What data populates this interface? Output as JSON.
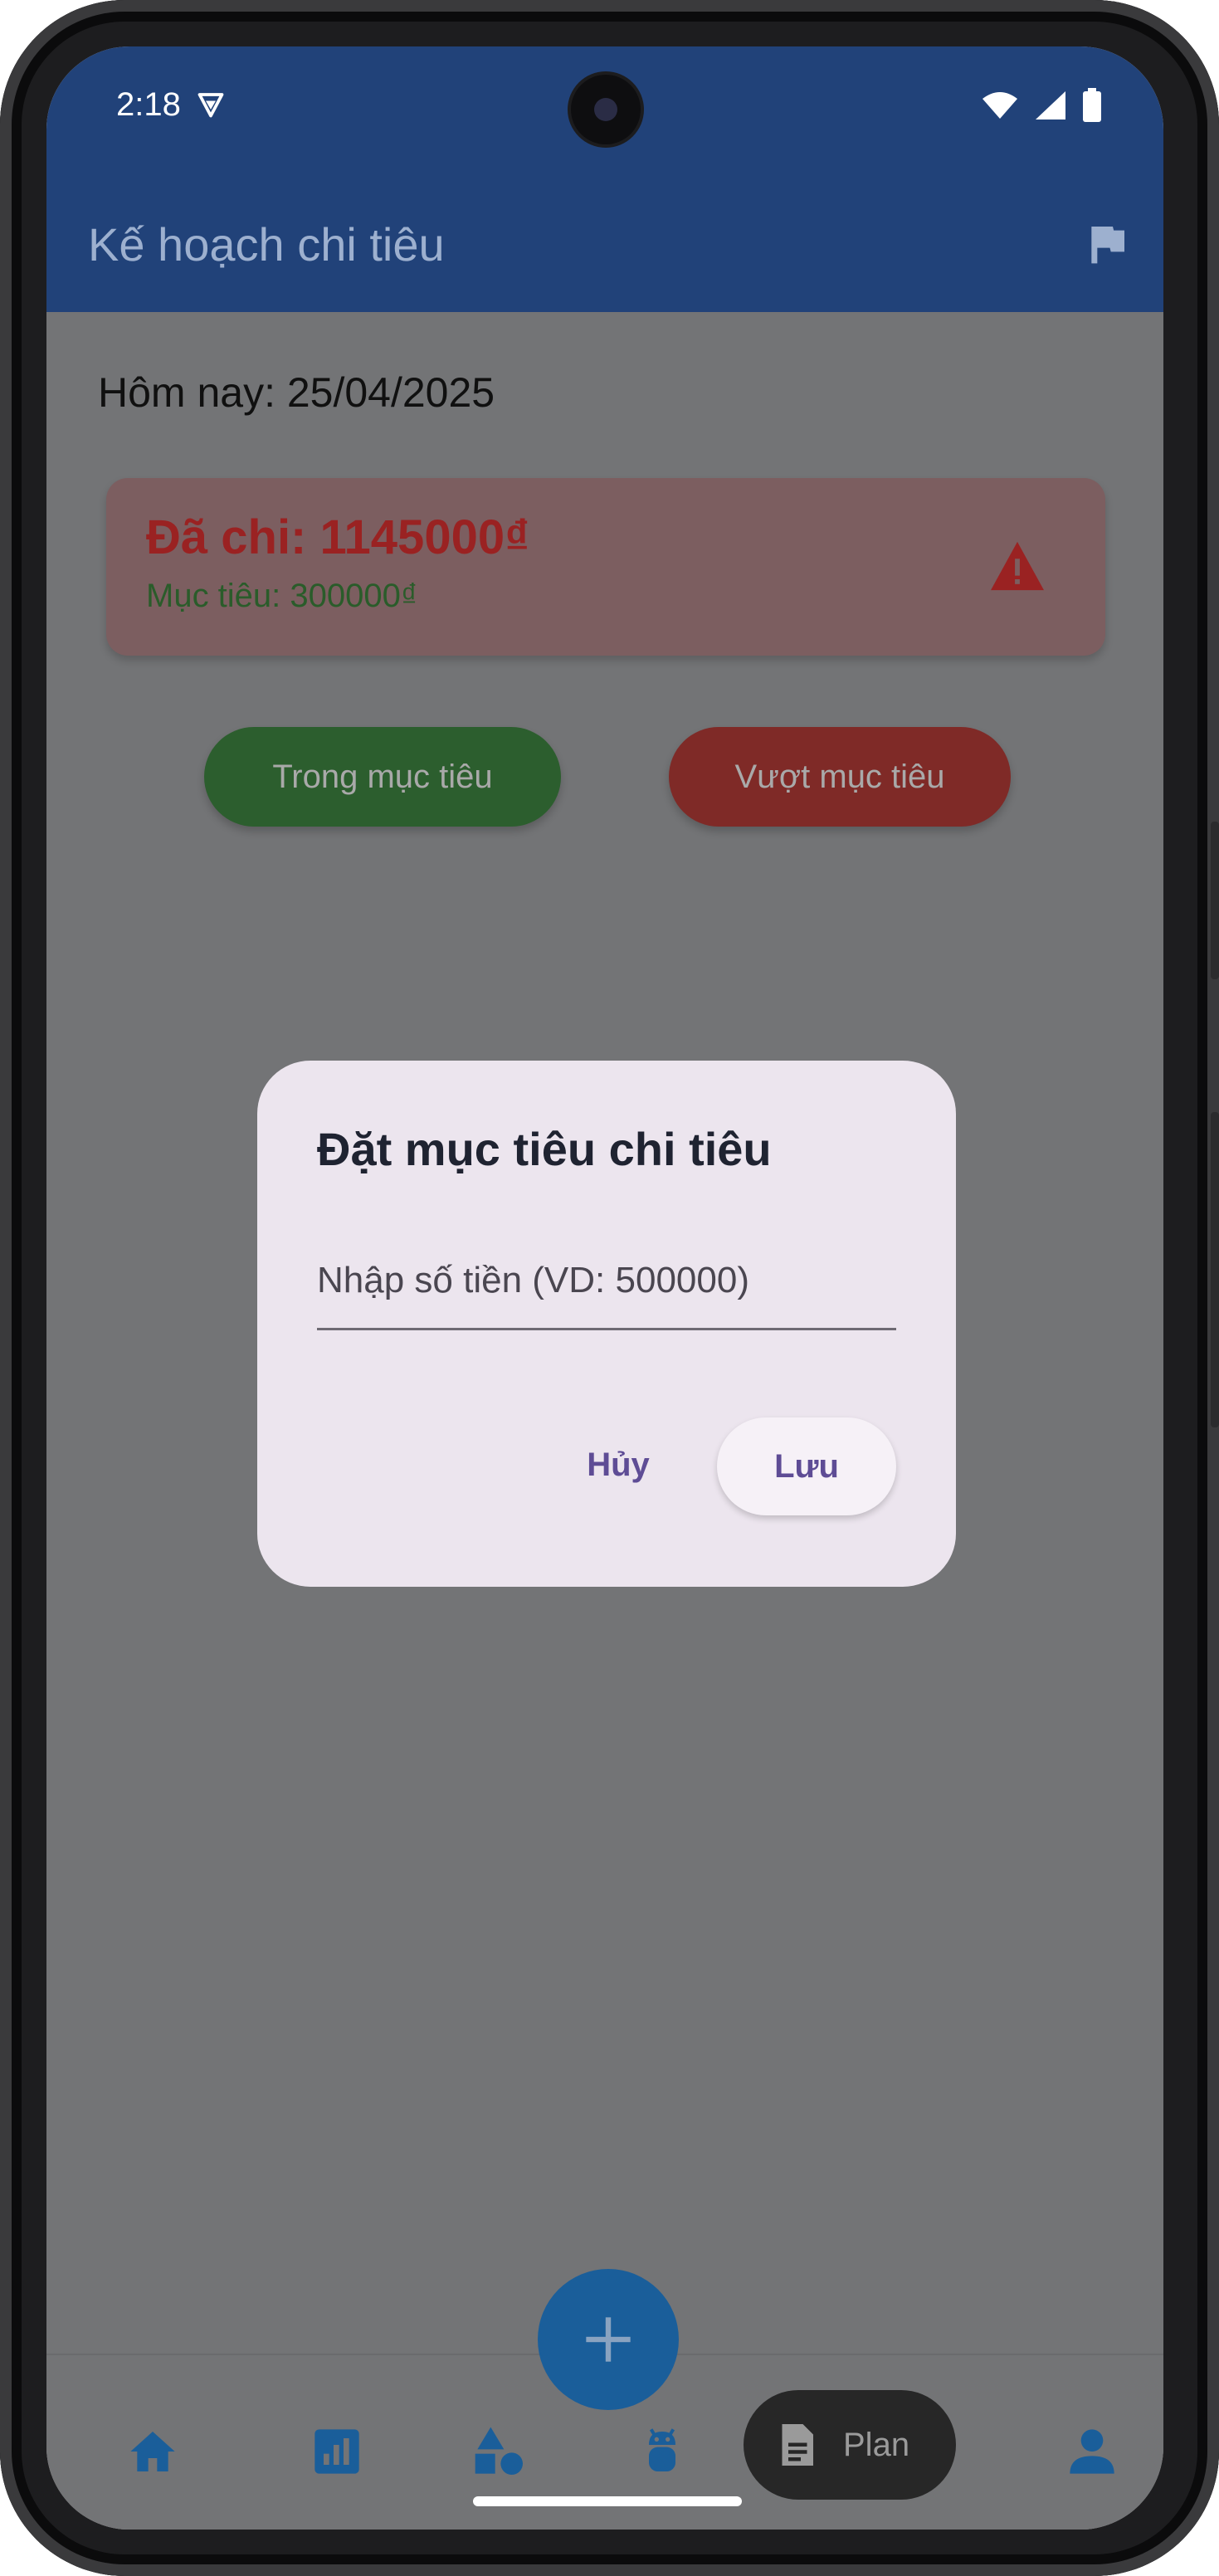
{
  "status_bar": {
    "time": "2:18"
  },
  "app_bar": {
    "title": "Kế hoạch chi tiêu"
  },
  "today": {
    "label": "Hôm nay: 25/04/2025"
  },
  "summary_card": {
    "spent": "Đã chi: 1145000₫",
    "target": "Mục tiêu: 300000₫"
  },
  "filter_buttons": {
    "in_target": "Trong mục tiêu",
    "over_target": "Vượt mục tiêu"
  },
  "dialog": {
    "title": "Đặt mục tiêu chi tiêu",
    "input_placeholder": "Nhập số tiền (VD: 500000)",
    "cancel_label": "Hủy",
    "save_label": "Lưu"
  },
  "bottom_nav": {
    "items": [
      "home-icon",
      "bar-chart-icon",
      "shapes-icon",
      "android-icon",
      "plan-document-icon",
      "person-icon"
    ],
    "active_label": "Plan"
  },
  "colors": {
    "app_bar": "#214279",
    "spent_text": "#9a2222",
    "target_text": "#2a5c2a",
    "in_target_button": "#2c5e2e",
    "over_target_button": "#7f2a27",
    "fab": "#1a5e9a",
    "dialog_bg": "#ece5ee",
    "dialog_action": "#5e4c95"
  }
}
